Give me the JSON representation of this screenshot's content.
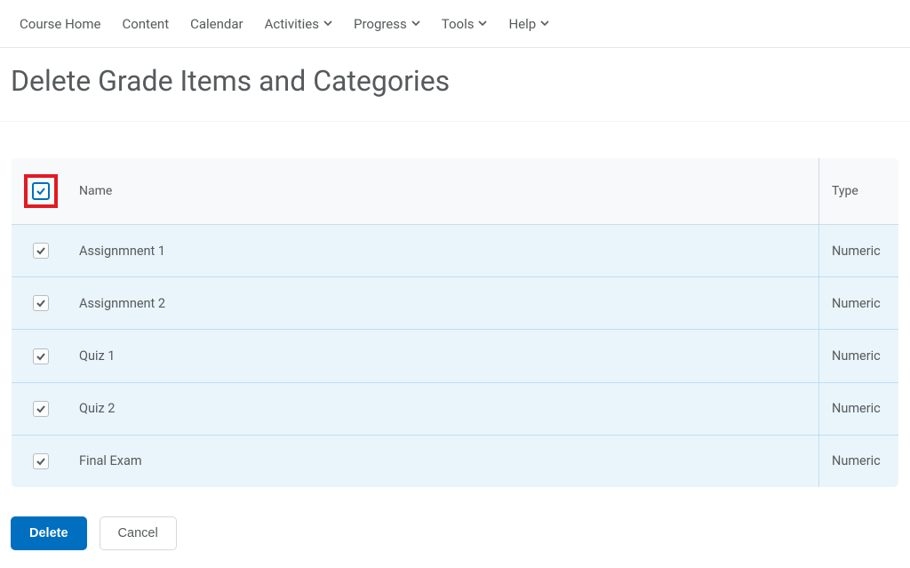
{
  "nav": {
    "items": [
      {
        "label": "Course Home",
        "dropdown": false
      },
      {
        "label": "Content",
        "dropdown": false
      },
      {
        "label": "Calendar",
        "dropdown": false
      },
      {
        "label": "Activities",
        "dropdown": true
      },
      {
        "label": "Progress",
        "dropdown": true
      },
      {
        "label": "Tools",
        "dropdown": true
      },
      {
        "label": "Help",
        "dropdown": true
      }
    ]
  },
  "page": {
    "title": "Delete Grade Items and Categories"
  },
  "table": {
    "headers": {
      "name": "Name",
      "type": "Type"
    },
    "select_all_checked": true,
    "rows": [
      {
        "name": "Assignmnent 1",
        "type": "Numeric",
        "checked": true
      },
      {
        "name": "Assignmnent 2",
        "type": "Numeric",
        "checked": true
      },
      {
        "name": "Quiz 1",
        "type": "Numeric",
        "checked": true
      },
      {
        "name": "Quiz 2",
        "type": "Numeric",
        "checked": true
      },
      {
        "name": "Final Exam",
        "type": "Numeric",
        "checked": true
      }
    ]
  },
  "buttons": {
    "delete": "Delete",
    "cancel": "Cancel"
  },
  "colors": {
    "primary": "#006fbf",
    "highlight": "#e11b22",
    "row_bg": "#eaf5fb"
  }
}
